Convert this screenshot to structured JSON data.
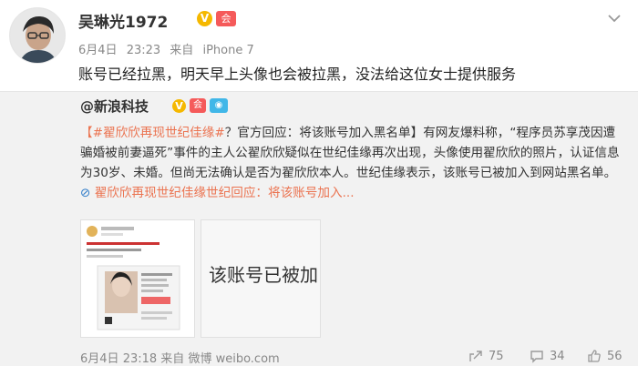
{
  "post": {
    "username": "吴琳光1972",
    "verified_badge": "V",
    "member_badge": "会",
    "date": "6月4日",
    "time": "23:23",
    "source_prefix": "来自",
    "source": "iPhone 7",
    "text": "账号已经拉黑，明天早上头像也会被拉黑，没法给这位女士提供服务"
  },
  "repost": {
    "author": "@新浪科技",
    "verified_badge": "V",
    "badge2": "会",
    "badge3": "◉",
    "topic": "【#翟欣欣再现世纪佳缘#",
    "headline": "？官方回应：将该账号加入黑名单】",
    "body": "有网友爆料称，“程序员苏享茂因遭骗婚被前妻逼死”事件的主人公翟欣欣疑似在世纪佳缘再次出现，头像使用翟欣欣的照片，认证信息为30岁、未婚。但尚无法确认是否为翟欣欣本人。世纪佳缘表示，该账号已被加入到网站黑名单。",
    "link_text": "翟欣欣再现世纪佳缘世纪回应：将该账号加入...",
    "image2_text": "该账号已被加",
    "footer": {
      "date": "6月4日",
      "time": "23:18",
      "source_prefix": "来自",
      "source": "微博 weibo.com",
      "reposts": "75",
      "comments": "34",
      "likes": "56"
    }
  },
  "colors": {
    "link": "#eb7350",
    "verified": "#f5b800",
    "repost_bg": "#f2f2f2"
  }
}
